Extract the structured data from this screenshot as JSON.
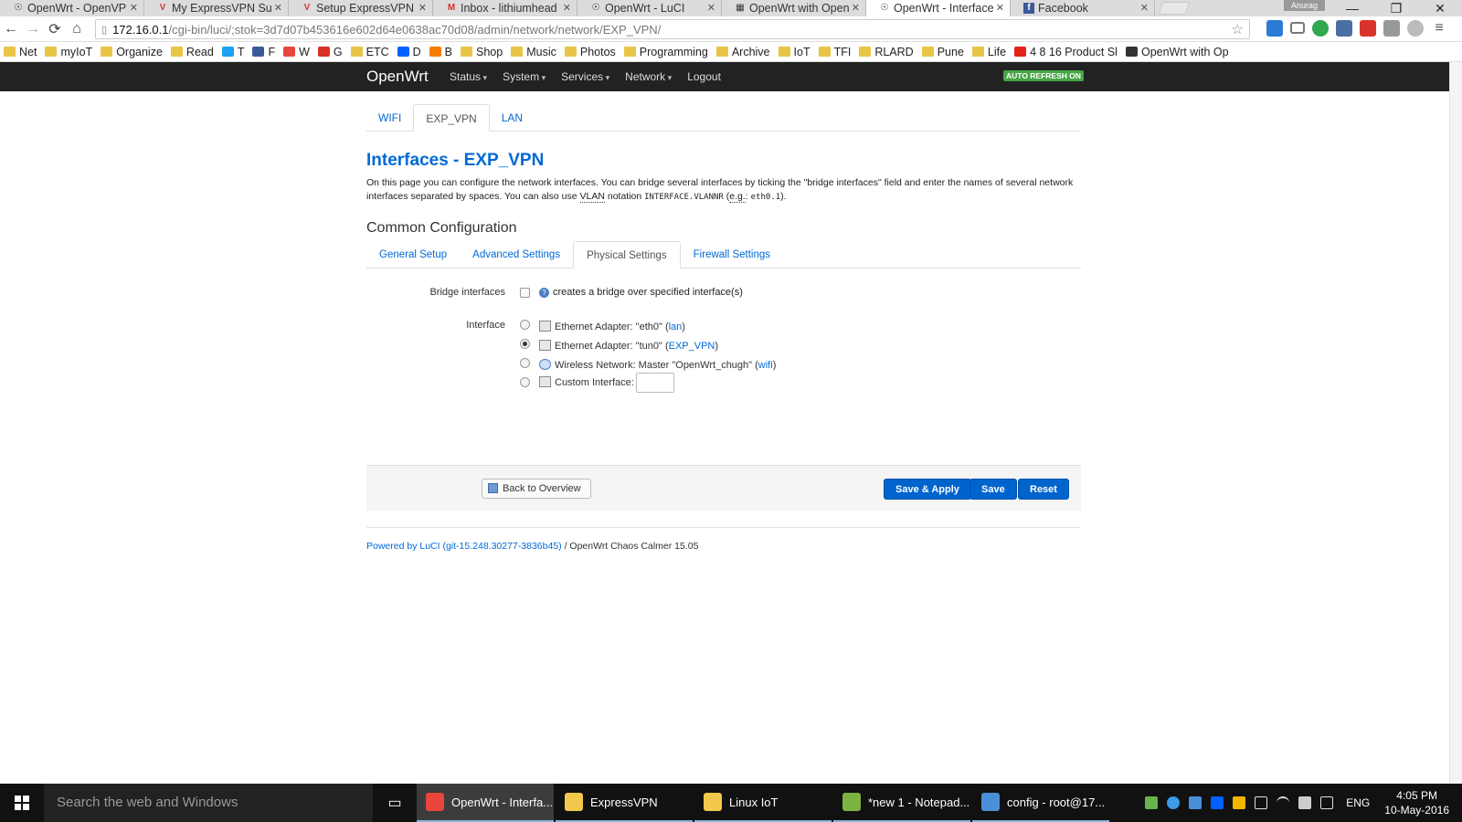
{
  "browser": {
    "tabs": [
      {
        "label": "OpenWrt - OpenVPN",
        "icon": "openwrt-icon"
      },
      {
        "label": "My ExpressVPN Subs",
        "icon": "expressvpn-icon"
      },
      {
        "label": "Setup ExpressVPN",
        "icon": "expressvpn-icon"
      },
      {
        "label": "Inbox - lithiumhead",
        "icon": "gmail-icon"
      },
      {
        "label": "OpenWrt - LuCI",
        "icon": "openwrt-icon"
      },
      {
        "label": "OpenWrt with Open",
        "icon": "page-icon"
      },
      {
        "label": "OpenWrt - Interface",
        "icon": "openwrt-icon"
      },
      {
        "label": "Facebook",
        "icon": "facebook-icon"
      }
    ],
    "profile": "Anurag",
    "url_host": "172.16.0.1",
    "url_path": "/cgi-bin/luci/;stok=3d7d07b453616e602d64e0638ac70d08/admin/network/network/EXP_VPN/",
    "bookmarks": [
      {
        "label": "Net",
        "type": "folder"
      },
      {
        "label": "myIoT",
        "type": "folder"
      },
      {
        "label": "Organize",
        "type": "folder"
      },
      {
        "label": "Read",
        "type": "folder"
      },
      {
        "label": "T",
        "type": "twitter"
      },
      {
        "label": "F",
        "type": "facebook"
      },
      {
        "label": "W",
        "type": "warn"
      },
      {
        "label": "G",
        "type": "gmail"
      },
      {
        "label": "ETC",
        "type": "folder"
      },
      {
        "label": "D",
        "type": "dropbox"
      },
      {
        "label": "B",
        "type": "blogger"
      },
      {
        "label": "Shop",
        "type": "folder"
      },
      {
        "label": "Music",
        "type": "folder"
      },
      {
        "label": "Photos",
        "type": "folder"
      },
      {
        "label": "Programming",
        "type": "folder"
      },
      {
        "label": "Archive",
        "type": "folder"
      },
      {
        "label": "IoT",
        "type": "folder"
      },
      {
        "label": "TFI",
        "type": "folder"
      },
      {
        "label": "RLARD",
        "type": "folder"
      },
      {
        "label": "Pune",
        "type": "folder"
      },
      {
        "label": "Life",
        "type": "folder"
      },
      {
        "label": "4 8 16 Product Sl",
        "type": "youtube"
      },
      {
        "label": "OpenWrt with Op",
        "type": "page"
      }
    ]
  },
  "luci": {
    "brand": "OpenWrt",
    "menu": [
      "Status",
      "System",
      "Services",
      "Network",
      "Logout"
    ],
    "auto_refresh": "AUTO REFRESH ON",
    "page_tabs": [
      {
        "label": "WIFI",
        "active": false
      },
      {
        "label": "EXP_VPN",
        "active": true
      },
      {
        "label": "LAN",
        "active": false
      }
    ],
    "title": "Interfaces - EXP_VPN",
    "desc_1": "On this page you can configure the network interfaces. You can bridge several interfaces by ticking the \"bridge interfaces\" field and enter the names of several network interfaces separated by spaces. You can also use ",
    "desc_vlan": "VLAN",
    "desc_2": " notation ",
    "desc_code1": "INTERFACE.VLANNR",
    "desc_3": " (",
    "desc_eg": "e.g.",
    "desc_4": ": ",
    "desc_code2": "eth0.1",
    "desc_5": ").",
    "section_title": "Common Configuration",
    "config_tabs": [
      {
        "label": "General Setup",
        "active": false
      },
      {
        "label": "Advanced Settings",
        "active": false
      },
      {
        "label": "Physical Settings",
        "active": true
      },
      {
        "label": "Firewall Settings",
        "active": false
      }
    ],
    "bridge_label": "Bridge interfaces",
    "bridge_hint": "creates a bridge over specified interface(s)",
    "interface_label": "Interface",
    "interfaces": [
      {
        "text": "Ethernet Adapter: \"eth0\" (",
        "link": "lan",
        "suffix": ")",
        "selected": false
      },
      {
        "text": "Ethernet Adapter: \"tun0\" (",
        "link": "EXP_VPN",
        "suffix": ")",
        "selected": true
      },
      {
        "text": "Wireless Network: Master \"OpenWrt_chugh\" (",
        "link": "wifi",
        "suffix": ")",
        "selected": false
      },
      {
        "text": "Custom Interface:",
        "link": "",
        "suffix": "",
        "selected": false
      }
    ],
    "custom_interface_value": "",
    "buttons": {
      "back": "Back to Overview",
      "save_apply": "Save & Apply",
      "save": "Save",
      "reset": "Reset"
    },
    "footer_link": "Powered by LuCI (git-15.248.30277-3836b45)",
    "footer_text": " / OpenWrt Chaos Calmer 15.05"
  },
  "taskbar": {
    "search_placeholder": "Search the web and Windows",
    "tasks": [
      {
        "label": "OpenWrt - Interfa...",
        "active": true,
        "color": "#e8453c"
      },
      {
        "label": "ExpressVPN",
        "active": false,
        "color": "#f2c94c"
      },
      {
        "label": "Linux IoT",
        "active": false,
        "color": "#f2c94c"
      },
      {
        "label": "*new 1 - Notepad...",
        "active": false,
        "color": "#7cb342"
      },
      {
        "label": "config - root@17...",
        "active": false,
        "color": "#4a90d9"
      }
    ],
    "lang": "ENG",
    "time": "4:05 PM",
    "date": "10-May-2016"
  }
}
